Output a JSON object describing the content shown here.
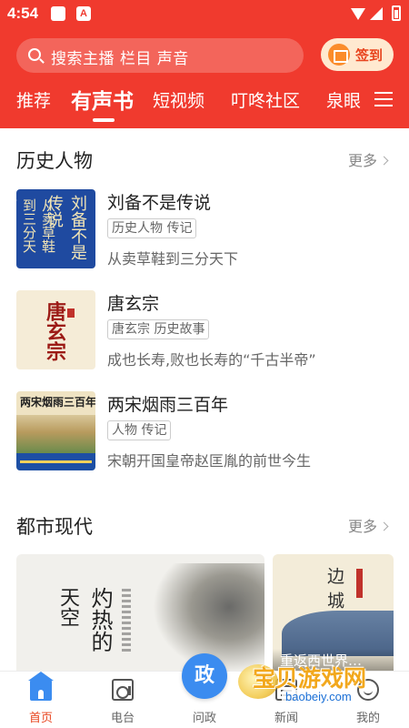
{
  "status_bar": {
    "time": "4:54",
    "app_icon_2": "A"
  },
  "header": {
    "search_placeholder": "搜索主播 栏目 声音",
    "signin_label": "签到",
    "tabs": [
      {
        "label": "推荐",
        "active": false
      },
      {
        "label": "有声书",
        "active": true
      },
      {
        "label": "短视频",
        "active": false
      },
      {
        "label": "叮咚社区",
        "active": false
      },
      {
        "label": "泉眼",
        "active": false
      }
    ],
    "colors": {
      "accent": "#f03a2e",
      "signin_bg": "#ffe9d0"
    }
  },
  "sections": [
    {
      "title": "历史人物",
      "more": "更多",
      "items": [
        {
          "title": "刘备不是传说",
          "tags": "历史人物 传记",
          "desc": "从卖草鞋到三分天下",
          "cover_text_main": "刘备不是传说",
          "cover_text_sub": "从卖草鞋到三分天下"
        },
        {
          "title": "唐玄宗",
          "tags": "唐玄宗 历史故事",
          "desc": "成也长寿,败也长寿的“千古半帝”",
          "cover_text_main": "唐玄宗"
        },
        {
          "title": "两宋烟雨三百年",
          "tags": "人物 传记",
          "desc": "宋朝开国皇帝赵匡胤的前世今生",
          "cover_text_main": "两宋烟雨三百年"
        }
      ]
    },
    {
      "title": "都市现代",
      "more": "更多",
      "cards": [
        {
          "cover_text_a": "天空",
          "cover_text_b": "灼热的"
        },
        {
          "cover_text": "边城",
          "caption": "重返西世界…"
        }
      ]
    }
  ],
  "bottom_nav": [
    {
      "label": "首页",
      "icon": "home-icon",
      "active": true
    },
    {
      "label": "电台",
      "icon": "radio-icon",
      "active": false
    },
    {
      "label": "问政",
      "icon": "politics-icon",
      "badge_text": "政",
      "active": false
    },
    {
      "label": "新闻",
      "icon": "news-icon",
      "active": false
    },
    {
      "label": "我的",
      "icon": "me-icon",
      "active": false
    }
  ],
  "watermark": {
    "text": "宝贝游戏网",
    "url": "baobeiy.com"
  }
}
